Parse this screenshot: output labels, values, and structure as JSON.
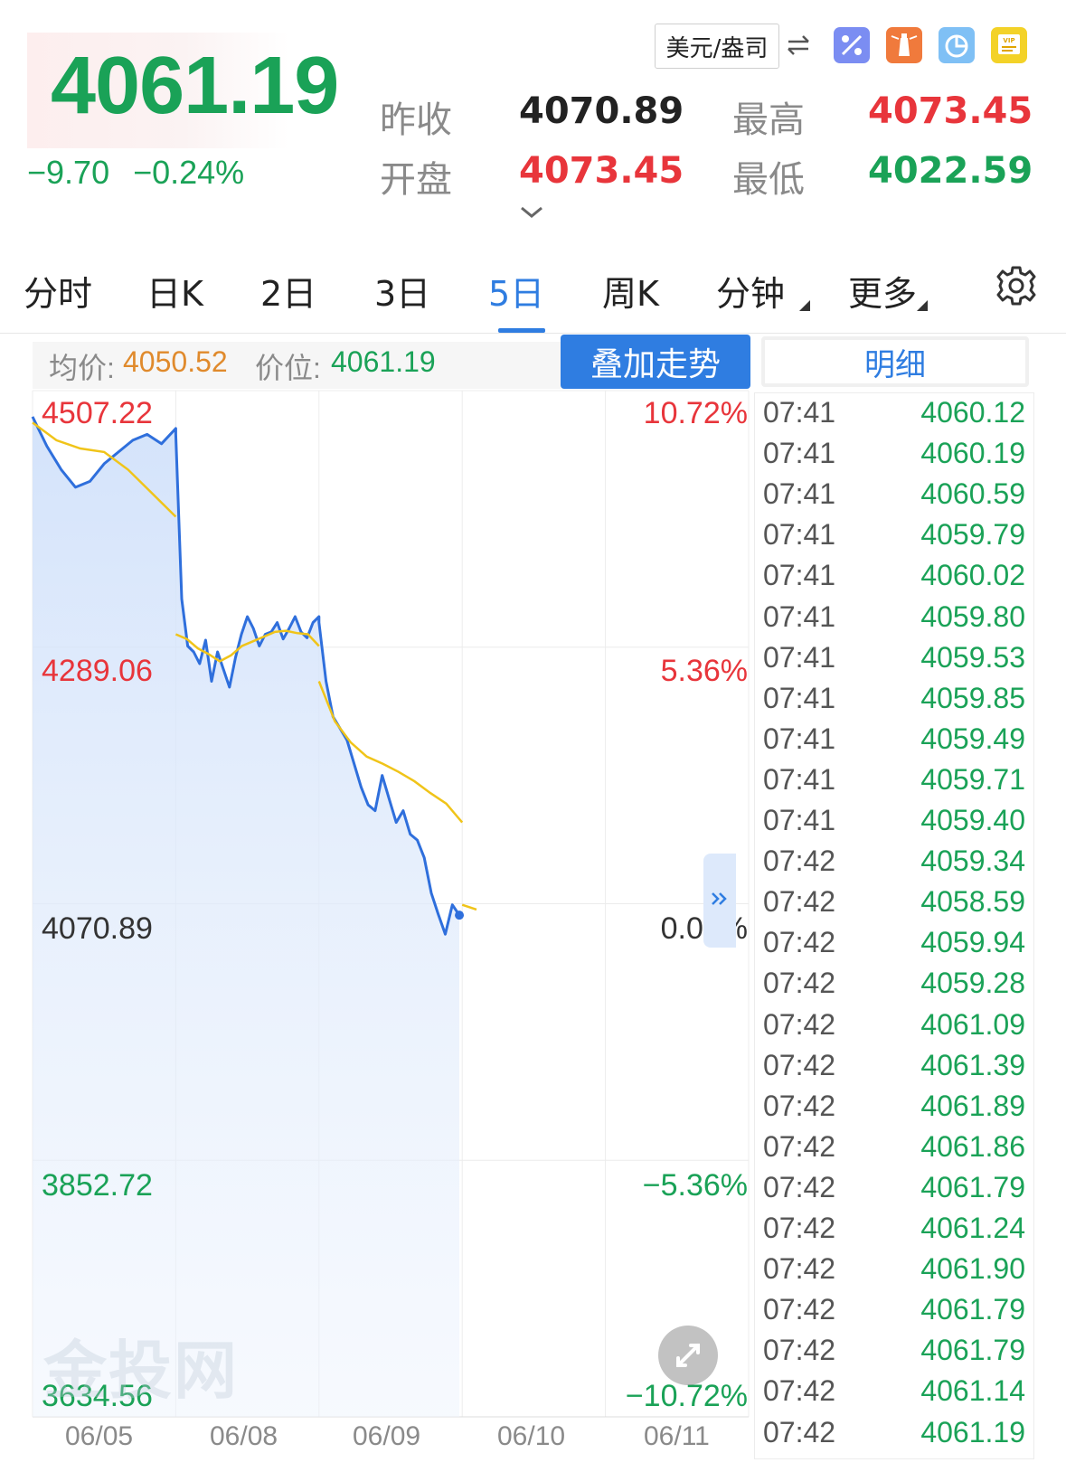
{
  "quote": {
    "last": "4061.19",
    "change": "−9.70",
    "change_pct": "−0.24%",
    "labels": {
      "prev_close": "昨收",
      "open": "开盘",
      "high": "最高",
      "low": "最低"
    },
    "prev_close": "4070.89",
    "open": "4073.45",
    "high": "4073.45",
    "low": "4022.59",
    "currency_unit": "美元/盎司"
  },
  "toolbar_icons": [
    "percent-icon",
    "lighthouse-icon",
    "pie-chart-icon",
    "vip-icon"
  ],
  "tabs": [
    {
      "label": "分时",
      "active": false
    },
    {
      "label": "日K",
      "active": false
    },
    {
      "label": "2日",
      "active": false
    },
    {
      "label": "3日",
      "active": false
    },
    {
      "label": "5日",
      "active": true
    },
    {
      "label": "周K",
      "active": false
    },
    {
      "label": "分钟",
      "active": false,
      "has_dropdown": true
    },
    {
      "label": "更多",
      "active": false,
      "has_dropdown": true
    }
  ],
  "chart_info": {
    "avg_label": "均价:",
    "avg_value": "4050.52",
    "price_label": "价位:",
    "price_value": "4061.19",
    "overlay_button": "叠加走势",
    "detail_tab": "明细"
  },
  "colors": {
    "up": "#e8353b",
    "down": "#1aa257",
    "accent": "#2f7de1",
    "avg_line": "#f0c419",
    "price_line": "#2f6fdc"
  },
  "watermark": "金投网",
  "chart_data": {
    "type": "line",
    "title": "",
    "xlabel": "",
    "ylabel": "",
    "ylim": [
      3634.56,
      4507.22
    ],
    "baseline": 4070.89,
    "y_ticks_left": [
      "4507.22",
      "4289.06",
      "4070.89",
      "3852.72",
      "3634.56"
    ],
    "y_ticks_right": [
      "10.72%",
      "5.36%",
      "0.00%",
      "−5.36%",
      "−10.72%"
    ],
    "x_ticks": [
      "06/05",
      "06/08",
      "06/09",
      "06/10",
      "06/11"
    ],
    "grid": true,
    "series": [
      {
        "role": "price",
        "days": [
          [
            4485,
            4460,
            4440,
            4425,
            4430,
            4445,
            4455,
            4465,
            4470,
            4462,
            4475
          ],
          [
            4470,
            4330,
            4290,
            4285,
            4275,
            4295,
            4260,
            4285,
            4270,
            4255,
            4280,
            4300,
            4315,
            4305,
            4290,
            4300,
            4302,
            4310,
            4296,
            4305,
            4315,
            4302,
            4297,
            4310,
            4315
          ],
          [
            4310,
            4260,
            4230,
            4220,
            4210,
            4190,
            4170,
            4155,
            4150,
            4180,
            4160,
            4140,
            4150,
            4130,
            4125,
            4110,
            4080,
            4062,
            4045,
            4070,
            4061.19
          ]
        ]
      },
      {
        "role": "average",
        "days": [
          [
            4480,
            4465,
            4458,
            4455,
            4440,
            4420,
            4400
          ],
          [
            4300,
            4296,
            4288,
            4283,
            4277,
            4282,
            4290,
            4294,
            4298,
            4302,
            4303,
            4301,
            4300,
            4290
          ],
          [
            4260,
            4226,
            4208,
            4196,
            4190,
            4183,
            4175,
            4165,
            4156,
            4140
          ],
          [
            4070,
            4066
          ]
        ]
      }
    ]
  },
  "trades": [
    {
      "time": "07:41",
      "price": "4060.12"
    },
    {
      "time": "07:41",
      "price": "4060.19"
    },
    {
      "time": "07:41",
      "price": "4060.59"
    },
    {
      "time": "07:41",
      "price": "4059.79"
    },
    {
      "time": "07:41",
      "price": "4060.02"
    },
    {
      "time": "07:41",
      "price": "4059.80"
    },
    {
      "time": "07:41",
      "price": "4059.53"
    },
    {
      "time": "07:41",
      "price": "4059.85"
    },
    {
      "time": "07:41",
      "price": "4059.49"
    },
    {
      "time": "07:41",
      "price": "4059.71"
    },
    {
      "time": "07:41",
      "price": "4059.40"
    },
    {
      "time": "07:42",
      "price": "4059.34"
    },
    {
      "time": "07:42",
      "price": "4058.59"
    },
    {
      "time": "07:42",
      "price": "4059.94"
    },
    {
      "time": "07:42",
      "price": "4059.28"
    },
    {
      "time": "07:42",
      "price": "4061.09"
    },
    {
      "time": "07:42",
      "price": "4061.39"
    },
    {
      "time": "07:42",
      "price": "4061.89"
    },
    {
      "time": "07:42",
      "price": "4061.86"
    },
    {
      "time": "07:42",
      "price": "4061.79"
    },
    {
      "time": "07:42",
      "price": "4061.24"
    },
    {
      "time": "07:42",
      "price": "4061.90"
    },
    {
      "time": "07:42",
      "price": "4061.79"
    },
    {
      "time": "07:42",
      "price": "4061.79"
    },
    {
      "time": "07:42",
      "price": "4061.14"
    },
    {
      "time": "07:42",
      "price": "4061.19"
    }
  ]
}
